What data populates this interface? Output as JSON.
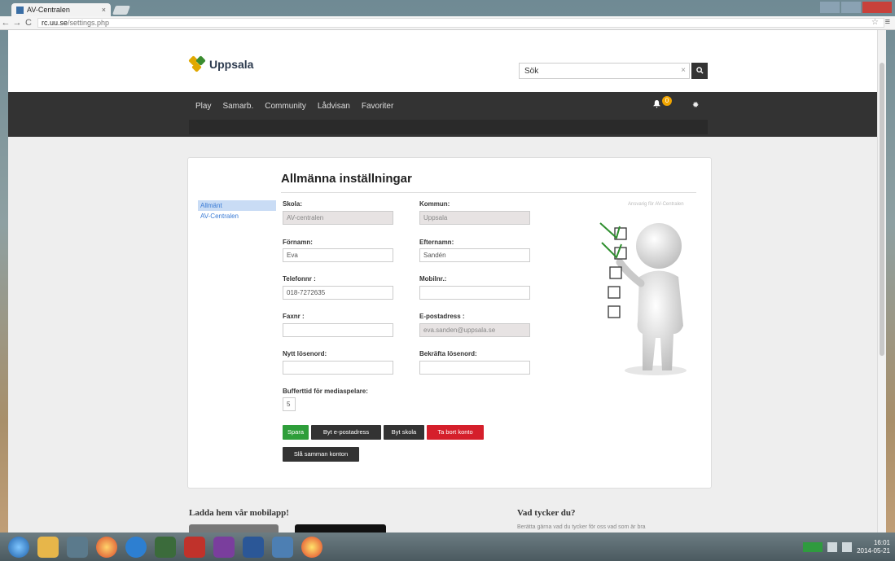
{
  "browser": {
    "tab_title": "AV-Centralen",
    "tab_close": "×",
    "url_host": "rc.uu.se",
    "url_path": "/settings.php",
    "back": "←",
    "forward": "→",
    "reload": "C",
    "star": "☆",
    "menu": "≡",
    "win_min": "",
    "win_max": "",
    "win_close": ""
  },
  "header": {
    "logo_text": "Uppsala",
    "search_value": "Sök",
    "search_clear": "×",
    "search_icon": "🔍"
  },
  "nav": {
    "items": [
      "Play",
      "Samarb.",
      "Community",
      "Lådvisan",
      "Favoriter"
    ],
    "badge_count": "0",
    "bell": "🔔",
    "gear": "✹"
  },
  "settings": {
    "title": "Allmänna inställningar",
    "sidebar": [
      {
        "label": "Allmänt",
        "active": true
      },
      {
        "label": "AV-Centralen",
        "active": false
      }
    ],
    "hint": "Ansvarig för AV-Centralen",
    "fields": {
      "skola_label": "Skola:",
      "skola_value": "AV-centralen",
      "kommun_label": "Kommun:",
      "kommun_value": "Uppsala",
      "fornamn_label": "Förnamn:",
      "fornamn_value": "Eva",
      "efternamn_label": "Efternamn:",
      "efternamn_value": "Sandén",
      "telefon_label": "Telefonnr :",
      "telefon_value": "018-7272635",
      "mobil_label": "Mobilnr.:",
      "mobil_value": "",
      "fax_label": "Faxnr :",
      "fax_value": "",
      "epost_label": "E-postadress :",
      "epost_value": "eva.sanden@uppsala.se",
      "nytt_label": "Nytt lösenord:",
      "nytt_value": "",
      "bekrafta_label": "Bekräfta lösenord:",
      "bekrafta_value": "",
      "buffert_label": "Bufferttid för mediaspelare:",
      "buffert_value": "5"
    },
    "buttons": {
      "spara": "Spara",
      "e_postadress": "Byt e-postadress",
      "skola": "Byt skola",
      "ta_bort": "Ta bort konto",
      "sla_samman": "Slå samman konton"
    }
  },
  "footer": {
    "app_heading": "Ladda hem vår mobilapp!",
    "feedback_heading": "Vad tycker du?",
    "feedback_text": "Berätta gärna vad du tycker för oss vad som är bra"
  },
  "taskbar": {
    "time": "16:01",
    "date": "2014-05-21"
  }
}
